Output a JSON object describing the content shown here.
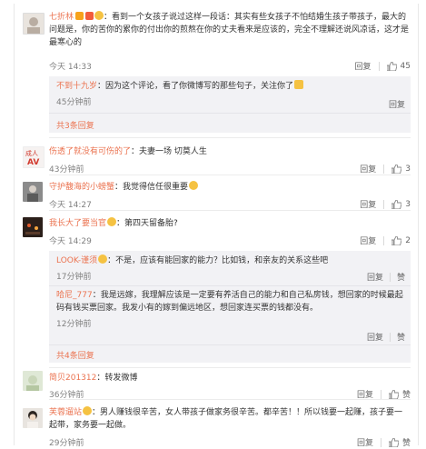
{
  "actions": {
    "reply": "回复",
    "like_label": "赞"
  },
  "comments": [
    {
      "user": "七折林",
      "text": "：看到一个女孩子说过这样一段话：其实有些女孩子不怕结婚生孩子带孩子，最大的问题是，你的苦你的累你的付出你的煎熬在你的丈夫看来是应该的，完全不理解还说风凉话，这才是最寒心的",
      "time": "今天 14:33",
      "likes": "45",
      "replies": [
        {
          "user": "不到十九岁",
          "text": "：因为这个评论，看了你微博写的那些句子，关注你了",
          "time": "45分钟前"
        }
      ],
      "more": "共3条回复"
    },
    {
      "user": "伤透了就没有可伤的了",
      "text": "：夫妻一场  切莫人生",
      "time": "43分钟前",
      "likes": "3"
    },
    {
      "user": "守护馥海的小螃蟹",
      "text": "：我觉得信任很重要",
      "time": "今天 14:27",
      "likes": "3"
    },
    {
      "user": "我长大了要当官",
      "text": "：第四天留备胎?",
      "time": "今天 14:29",
      "likes": "2",
      "replies": [
        {
          "user": "LOOK-谨须",
          "text": "：不是，应该有能回家的能力？比如钱，和亲友的关系这些吧",
          "time": "17分钟前"
        },
        {
          "user": "哈尼_777",
          "text": "：我是远嫁，我理解应该是一定要有养活自己的能力和自己私房钱，想回家的时候最起码有钱买票回家。我发小有的嫁到偏远地区，想回家连买票的钱都没有。",
          "time": "12分钟前"
        }
      ],
      "more": "共4条回复"
    },
    {
      "user": "简贝201312",
      "text": "：转发微博",
      "time": "36分钟前",
      "likes": "赞"
    },
    {
      "user": "芙蓉遛站",
      "text": "：男人赚钱很辛苦，女人带孩子做家务很辛苦。都辛苦！！所以钱要一起赚，孩子要一起带，家务要一起做。",
      "time": "29分钟前",
      "likes": "赞"
    }
  ]
}
